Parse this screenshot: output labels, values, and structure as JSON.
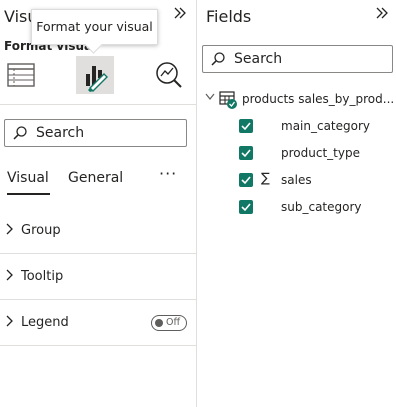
{
  "visualizations_pane": {
    "title": "Visu",
    "collapse_icon": "double-chevron-right-icon",
    "subtitle": "Format visual",
    "tooltip": "Format your visual",
    "modes": [
      {
        "name": "build-visual",
        "icon": "build-visual-icon"
      },
      {
        "name": "format-visual",
        "icon": "format-visual-icon",
        "selected": true
      },
      {
        "name": "analytics",
        "icon": "analytics-icon"
      }
    ],
    "search": {
      "placeholder": "Search",
      "icon": "search-icon"
    },
    "tabs": [
      {
        "label": "Visual",
        "selected": true
      },
      {
        "label": "General",
        "selected": false
      }
    ],
    "more_label": "···",
    "sections": [
      {
        "label": "Group",
        "expanded": false
      },
      {
        "label": "Tooltip",
        "expanded": false
      },
      {
        "label": "Legend",
        "expanded": false,
        "toggle": "Off"
      }
    ]
  },
  "fields_pane": {
    "title": "Fields",
    "collapse_icon": "double-chevron-right-icon",
    "search": {
      "placeholder": "Search",
      "icon": "search-icon"
    },
    "table": {
      "name": "products sales_by_prod...",
      "expanded": true,
      "icon": "table-icon"
    },
    "fields": [
      {
        "name": "main_category",
        "checked": true,
        "sigma": ""
      },
      {
        "name": "product_type",
        "checked": true,
        "sigma": ""
      },
      {
        "name": "sales",
        "checked": true,
        "sigma": "∑"
      },
      {
        "name": "sub_category",
        "checked": true,
        "sigma": ""
      }
    ]
  },
  "colors": {
    "accent": "#117865",
    "selected_bg": "#e1dfdd",
    "border": "#8a8886"
  }
}
